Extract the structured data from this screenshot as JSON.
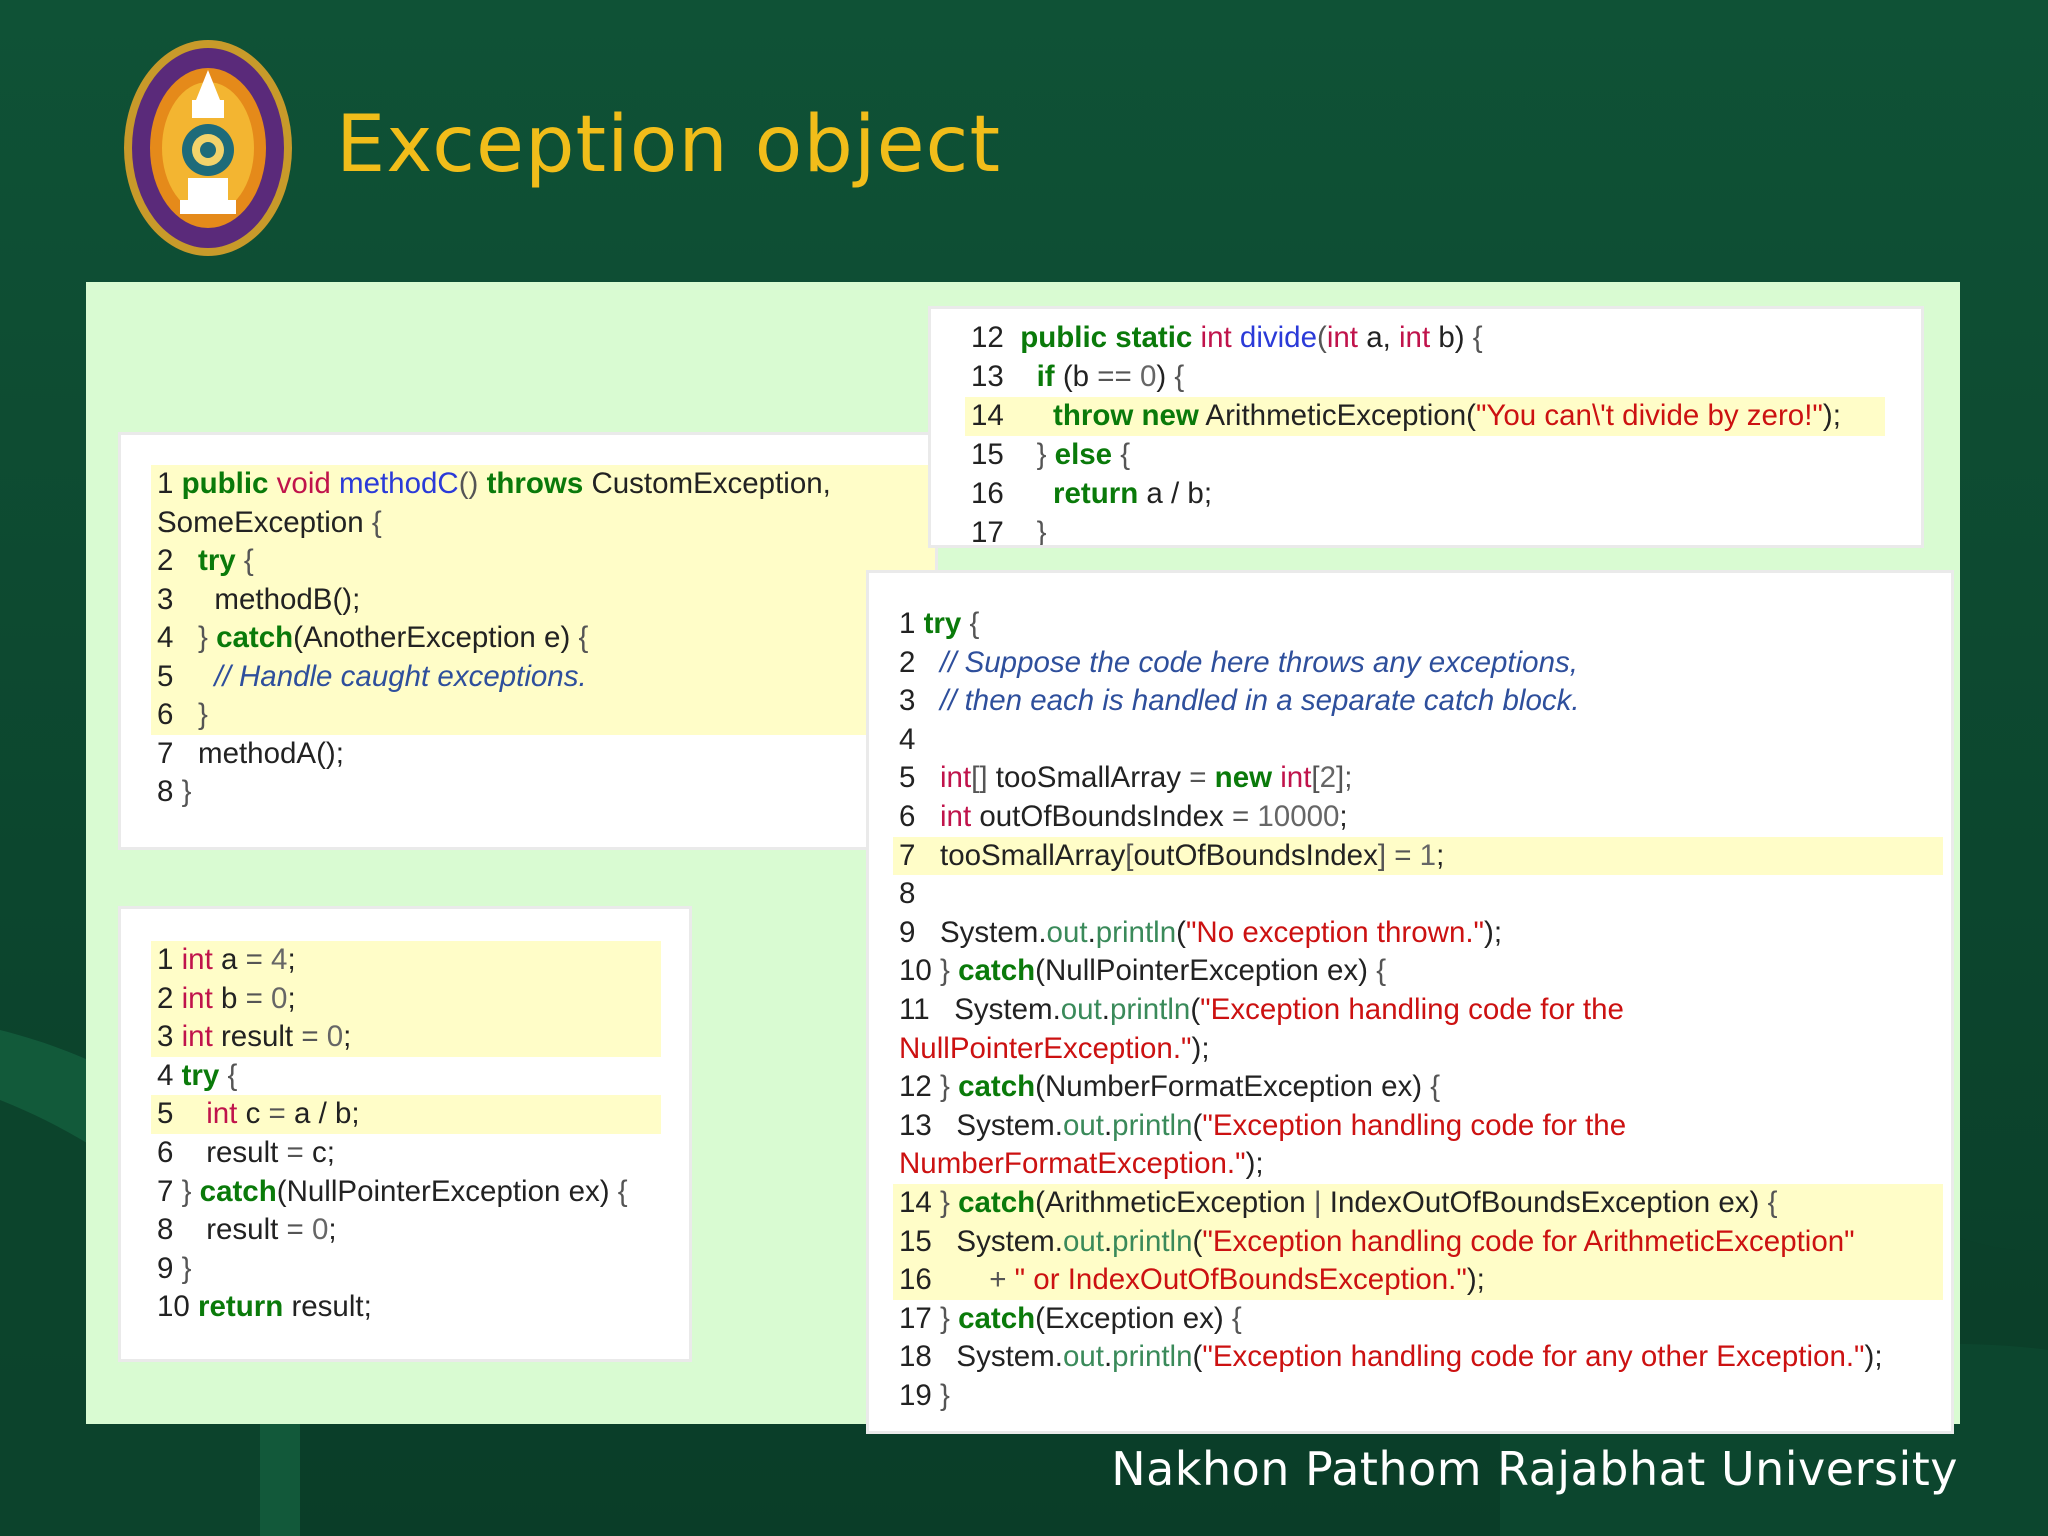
{
  "slide": {
    "title": "Exception object",
    "footer": "Nakhon Pathom Rajabhat University",
    "colors": {
      "background": "#0e4d33",
      "title": "#f1bd1a",
      "panel": "#d9fbd2",
      "highlight": "#fffdc8",
      "keyword": "#0a7a0a",
      "type": "#c0134b",
      "method": "#2a3ad8",
      "string": "#cc1111",
      "comment": "#2e4f9c"
    },
    "logo_icon": "university-seal-icon"
  },
  "code_blocks": {
    "method_c": {
      "lines": [
        [
          [
            "1 ",
            ""
          ],
          [
            "public",
            "kw"
          ],
          [
            " ",
            ""
          ],
          [
            "void",
            "ty"
          ],
          [
            " ",
            ""
          ],
          [
            "methodC",
            "fn"
          ],
          [
            "()",
            "pu"
          ],
          [
            " ",
            ""
          ],
          [
            "throws",
            "kw"
          ],
          [
            " CustomException,",
            ""
          ]
        ],
        [
          [
            "SomeException ",
            ""
          ],
          [
            "{",
            "pu"
          ]
        ],
        [
          [
            "2   ",
            ""
          ],
          [
            "try",
            "kw"
          ],
          [
            " ",
            ""
          ],
          [
            "{",
            "pu"
          ]
        ],
        [
          [
            "3     methodB();",
            ""
          ]
        ],
        [
          [
            "4   ",
            ""
          ],
          [
            "}",
            "pu"
          ],
          [
            " ",
            ""
          ],
          [
            "catch",
            "kw"
          ],
          [
            "(AnotherException e) ",
            ""
          ],
          [
            "{",
            "pu"
          ]
        ],
        [
          [
            "5     ",
            ""
          ],
          [
            "// Handle caught exceptions.",
            "cm"
          ]
        ],
        [
          [
            "6   ",
            ""
          ],
          [
            "}",
            "pu"
          ]
        ],
        [
          [
            "7   methodA();",
            ""
          ]
        ],
        [
          [
            "8 ",
            ""
          ],
          [
            "}",
            "pu"
          ]
        ]
      ]
    },
    "divide": {
      "lines": [
        [
          [
            "12  ",
            ""
          ],
          [
            "public static",
            "kw"
          ],
          [
            " ",
            ""
          ],
          [
            "int",
            "ty"
          ],
          [
            " ",
            ""
          ],
          [
            "divide",
            "fn"
          ],
          [
            "(",
            "pu"
          ],
          [
            "int",
            "ty"
          ],
          [
            " a, ",
            ""
          ],
          [
            "int",
            "ty"
          ],
          [
            " b) ",
            ""
          ],
          [
            "{",
            "pu"
          ]
        ],
        [
          [
            "13    ",
            ""
          ],
          [
            "if",
            "kw"
          ],
          [
            " (b ",
            ""
          ],
          [
            "==",
            "pu"
          ],
          [
            " ",
            ""
          ],
          [
            "0",
            "num"
          ],
          [
            ") ",
            ""
          ],
          [
            "{",
            "pu"
          ]
        ],
        [
          [
            "14      ",
            ""
          ],
          [
            "throw new",
            "kw"
          ],
          [
            " ArithmeticException(",
            ""
          ],
          [
            "\"You can\\'t divide by zero!\"",
            "str"
          ],
          [
            ");",
            ""
          ]
        ],
        [
          [
            "15    ",
            ""
          ],
          [
            "}",
            "pu"
          ],
          [
            " ",
            ""
          ],
          [
            "else",
            "kw"
          ],
          [
            " ",
            ""
          ],
          [
            "{",
            "pu"
          ]
        ],
        [
          [
            "16      ",
            ""
          ],
          [
            "return",
            "kw"
          ],
          [
            " a / b;",
            ""
          ]
        ],
        [
          [
            "17    ",
            ""
          ],
          [
            "}",
            "pu"
          ]
        ]
      ]
    },
    "divide_by_zero": {
      "lines": [
        [
          [
            "1 ",
            ""
          ],
          [
            "int",
            "ty"
          ],
          [
            " a ",
            ""
          ],
          [
            "=",
            "pu"
          ],
          [
            " ",
            ""
          ],
          [
            "4",
            "num"
          ],
          [
            ";",
            ""
          ]
        ],
        [
          [
            "2 ",
            ""
          ],
          [
            "int",
            "ty"
          ],
          [
            " b ",
            ""
          ],
          [
            "=",
            "pu"
          ],
          [
            " ",
            ""
          ],
          [
            "0",
            "num"
          ],
          [
            ";",
            ""
          ]
        ],
        [
          [
            "3 ",
            ""
          ],
          [
            "int",
            "ty"
          ],
          [
            " result ",
            ""
          ],
          [
            "=",
            "pu"
          ],
          [
            " ",
            ""
          ],
          [
            "0",
            "num"
          ],
          [
            ";",
            ""
          ]
        ],
        [
          [
            "4 ",
            ""
          ],
          [
            "try",
            "kw"
          ],
          [
            " ",
            ""
          ],
          [
            "{",
            "pu"
          ]
        ],
        [
          [
            "5    ",
            ""
          ],
          [
            "int",
            "ty"
          ],
          [
            " c ",
            ""
          ],
          [
            "=",
            "pu"
          ],
          [
            " a / b;",
            ""
          ]
        ],
        [
          [
            "6    result ",
            ""
          ],
          [
            "=",
            "pu"
          ],
          [
            " c;",
            ""
          ]
        ],
        [
          [
            "7 ",
            ""
          ],
          [
            "}",
            "pu"
          ],
          [
            " ",
            ""
          ],
          [
            "catch",
            "kw"
          ],
          [
            "(NullPointerException ex) ",
            ""
          ],
          [
            "{",
            "pu"
          ]
        ],
        [
          [
            "8    result ",
            ""
          ],
          [
            "=",
            "pu"
          ],
          [
            " ",
            ""
          ],
          [
            "0",
            "num"
          ],
          [
            ";",
            ""
          ]
        ],
        [
          [
            "9 ",
            ""
          ],
          [
            "}",
            "pu"
          ]
        ],
        [
          [
            "10 ",
            ""
          ],
          [
            "return",
            "kw"
          ],
          [
            " result;",
            ""
          ]
        ]
      ]
    },
    "multi_catch": {
      "lines": [
        [
          [
            "1 ",
            ""
          ],
          [
            "try",
            "kw"
          ],
          [
            " ",
            ""
          ],
          [
            "{",
            "pu"
          ]
        ],
        [
          [
            "2   ",
            ""
          ],
          [
            "// Suppose the code here throws any exceptions,",
            "cm"
          ]
        ],
        [
          [
            "3   ",
            ""
          ],
          [
            "// then each is handled in a separate catch block.",
            "cm"
          ]
        ],
        [
          [
            "4",
            ""
          ]
        ],
        [
          [
            "5   ",
            ""
          ],
          [
            "int",
            "ty"
          ],
          [
            "[]",
            "pu"
          ],
          [
            " tooSmallArray ",
            ""
          ],
          [
            "=",
            "pu"
          ],
          [
            " ",
            ""
          ],
          [
            "new",
            "kw"
          ],
          [
            " ",
            ""
          ],
          [
            "int",
            "ty"
          ],
          [
            "[",
            "pu"
          ],
          [
            "2",
            "num"
          ],
          [
            "];",
            "pu"
          ]
        ],
        [
          [
            "6   ",
            ""
          ],
          [
            "int",
            "ty"
          ],
          [
            " outOfBoundsIndex ",
            ""
          ],
          [
            "=",
            "pu"
          ],
          [
            " ",
            ""
          ],
          [
            "10000",
            "num"
          ],
          [
            ";",
            ""
          ]
        ],
        [
          [
            "7   tooSmallArray",
            ""
          ],
          [
            "[",
            "pu"
          ],
          [
            "outOfBoundsIndex",
            ""
          ],
          [
            "]",
            "pu"
          ],
          [
            " ",
            ""
          ],
          [
            "=",
            "pu"
          ],
          [
            " ",
            ""
          ],
          [
            "1",
            "num"
          ],
          [
            ";",
            ""
          ]
        ],
        [
          [
            "8",
            ""
          ]
        ],
        [
          [
            "9   System.",
            ""
          ],
          [
            "out",
            "fld"
          ],
          [
            ".",
            ""
          ],
          [
            "println",
            "fld"
          ],
          [
            "(",
            ""
          ],
          [
            "\"No exception thrown.\"",
            "str"
          ],
          [
            ");",
            ""
          ]
        ],
        [
          [
            "10 ",
            ""
          ],
          [
            "}",
            "pu"
          ],
          [
            " ",
            ""
          ],
          [
            "catch",
            "kw"
          ],
          [
            "(NullPointerException ex) ",
            ""
          ],
          [
            "{",
            "pu"
          ]
        ],
        [
          [
            "11   System.",
            ""
          ],
          [
            "out",
            "fld"
          ],
          [
            ".",
            ""
          ],
          [
            "println",
            "fld"
          ],
          [
            "(",
            ""
          ],
          [
            "\"Exception handling code for the",
            "str"
          ]
        ],
        [
          [
            "NullPointerException.\"",
            "str"
          ],
          [
            ");",
            ""
          ]
        ],
        [
          [
            "12 ",
            ""
          ],
          [
            "}",
            "pu"
          ],
          [
            " ",
            ""
          ],
          [
            "catch",
            "kw"
          ],
          [
            "(NumberFormatException ex) ",
            ""
          ],
          [
            "{",
            "pu"
          ]
        ],
        [
          [
            "13   System.",
            ""
          ],
          [
            "out",
            "fld"
          ],
          [
            ".",
            ""
          ],
          [
            "println",
            "fld"
          ],
          [
            "(",
            ""
          ],
          [
            "\"Exception handling code for the",
            "str"
          ]
        ],
        [
          [
            "NumberFormatException.\"",
            "str"
          ],
          [
            ");",
            ""
          ]
        ],
        [
          [
            "14 ",
            ""
          ],
          [
            "}",
            "pu"
          ],
          [
            " ",
            ""
          ],
          [
            "catch",
            "kw"
          ],
          [
            "(ArithmeticException ",
            ""
          ],
          [
            "|",
            "pu"
          ],
          [
            " IndexOutOfBoundsException ex) ",
            ""
          ],
          [
            "{",
            "pu"
          ]
        ],
        [
          [
            "15   System.",
            ""
          ],
          [
            "out",
            "fld"
          ],
          [
            ".",
            ""
          ],
          [
            "println",
            "fld"
          ],
          [
            "(",
            ""
          ],
          [
            "\"Exception handling code for ArithmeticException\"",
            "str"
          ]
        ],
        [
          [
            "16       ",
            ""
          ],
          [
            "+",
            "pu"
          ],
          [
            " ",
            ""
          ],
          [
            "\" or IndexOutOfBoundsException.\"",
            "str"
          ],
          [
            ");",
            ""
          ]
        ],
        [
          [
            "17 ",
            ""
          ],
          [
            "}",
            "pu"
          ],
          [
            " ",
            ""
          ],
          [
            "catch",
            "kw"
          ],
          [
            "(Exception ex) ",
            ""
          ],
          [
            "{",
            "pu"
          ]
        ],
        [
          [
            "18   System.",
            ""
          ],
          [
            "out",
            "fld"
          ],
          [
            ".",
            ""
          ],
          [
            "println",
            "fld"
          ],
          [
            "(",
            ""
          ],
          [
            "\"Exception handling code for any other Exception.\"",
            "str"
          ],
          [
            ");",
            ""
          ]
        ],
        [
          [
            "19 ",
            ""
          ],
          [
            "}",
            "pu"
          ]
        ]
      ]
    }
  }
}
